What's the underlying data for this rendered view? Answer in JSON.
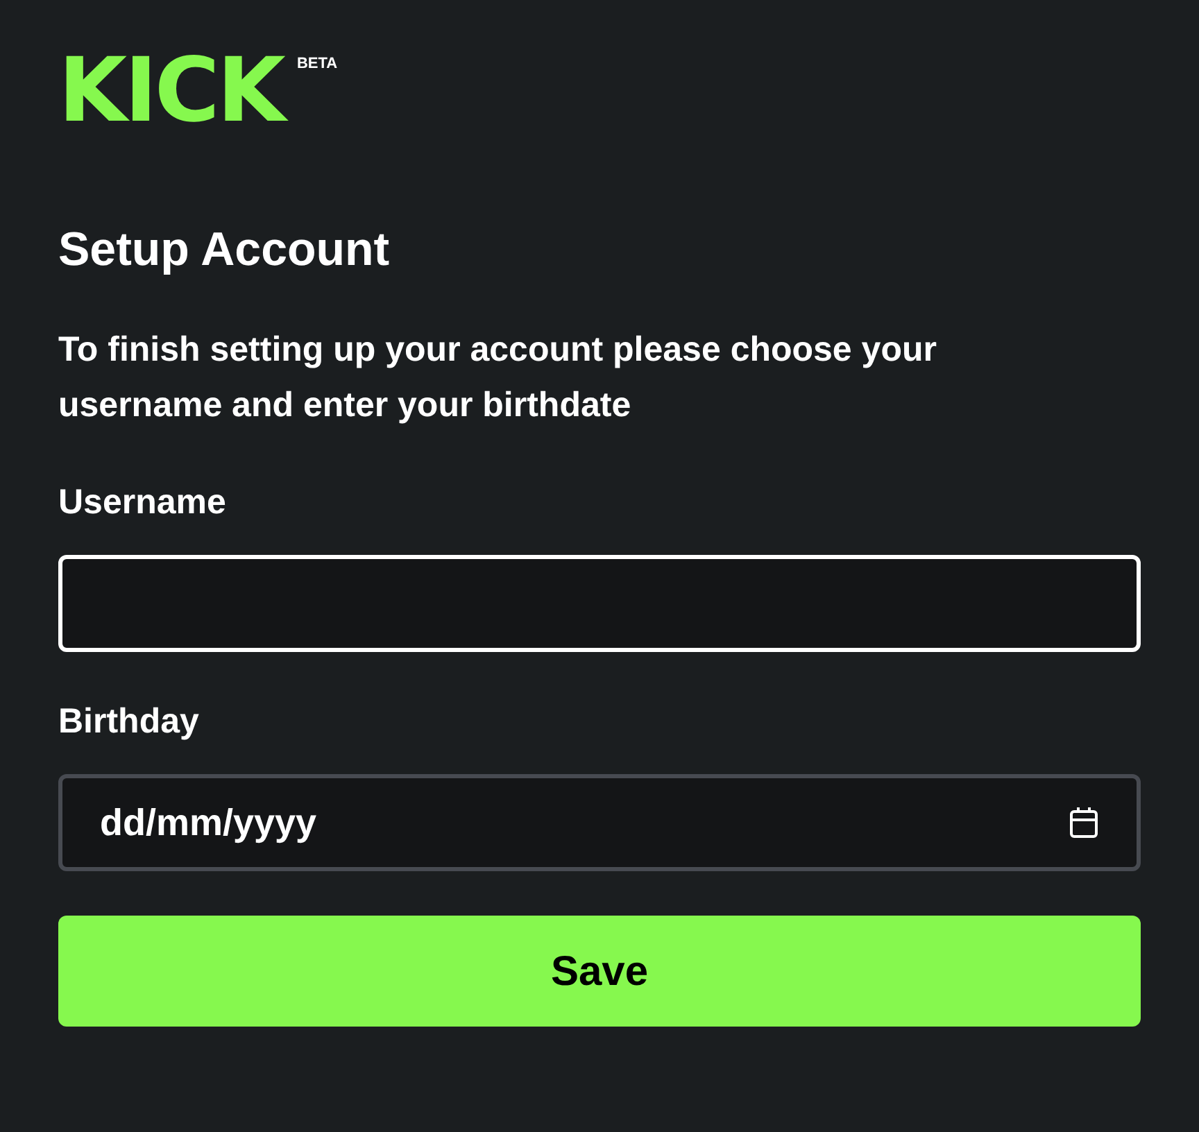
{
  "logo": {
    "text": "KICK",
    "badge": "BETA"
  },
  "title": "Setup Account",
  "description": "To finish setting up your account please choose your username and enter your birthdate",
  "fields": [
    {
      "label": "Username",
      "kind": "text",
      "focused": true
    },
    {
      "label": "Birthday",
      "kind": "date",
      "placeholder": "dd/mm/yyyy",
      "focused": false
    }
  ],
  "button": {
    "label": "Save"
  }
}
